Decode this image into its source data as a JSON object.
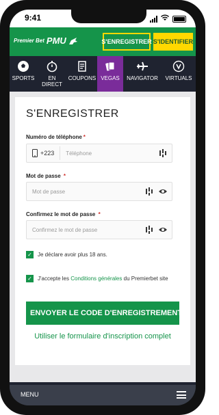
{
  "status_bar": {
    "time": "9:41"
  },
  "header": {
    "logo_text_1": "Premier Bet",
    "logo_text_2": "PMU",
    "register_button": "S'ENREGISTRER",
    "login_button": "S'IDENTIFIER",
    "colors": {
      "brand_green": "#15944a",
      "accent_yellow": "#ffd800"
    }
  },
  "nav": {
    "items": [
      {
        "label": "SPORTS",
        "icon": "soccer-ball-icon",
        "active": false
      },
      {
        "label": "EN DIRECT",
        "icon": "stopwatch-icon",
        "active": false
      },
      {
        "label": "COUPONS",
        "icon": "coupon-icon",
        "active": false
      },
      {
        "label": "VEGAS",
        "icon": "cards-icon",
        "active": true
      },
      {
        "label": "NAVIGATOR",
        "icon": "airplane-icon",
        "active": false
      },
      {
        "label": "VIRTUALS",
        "icon": "virtuals-icon",
        "active": false
      }
    ],
    "active_color": "#7a2c9a"
  },
  "form": {
    "title": "S'ENREGISTRER",
    "phone": {
      "label": "Numéro de téléphone",
      "required_mark": "*",
      "prefix": "+223",
      "placeholder": "Téléphone",
      "value": ""
    },
    "password": {
      "label": "Mot de passe",
      "required_mark": "*",
      "placeholder": "Mot de passe",
      "value": ""
    },
    "confirm_password": {
      "label": "Confirmez le mot de passe",
      "required_mark": "*",
      "placeholder": "Confirmez le mot de passe",
      "value": ""
    },
    "age_checkbox": {
      "text": "Je déclare avoir plus 18 ans.",
      "checked": true
    },
    "terms_checkbox": {
      "text_before": "J'accepte les ",
      "link_text": "Conditions générales",
      "text_after": " du Premierbet site",
      "checked": true
    },
    "submit_button": "ENVOYER LE CODE D'ENREGISTREMENT",
    "full_form_link": "Utiliser le formulaire d'inscription complet"
  },
  "footer": {
    "menu_label": "MENU"
  }
}
